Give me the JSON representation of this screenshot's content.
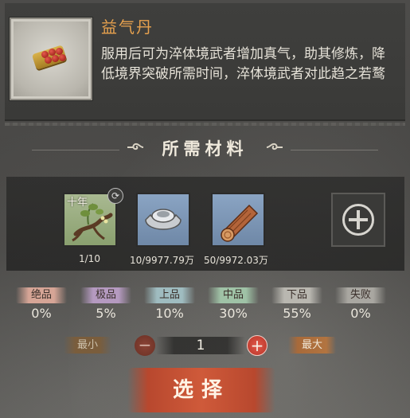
{
  "item": {
    "name": "益气丹",
    "description": "服用后可为淬体境武者增加真气，助其修炼，降低境界突破所需时间，淬体境武者对此趋之若鹜"
  },
  "materials_section": {
    "title": "所需材料"
  },
  "materials": [
    {
      "icon": "herb-root-icon",
      "tag": "十年",
      "count": "1/10"
    },
    {
      "icon": "silver-ingot-icon",
      "count": "10/9977.79万"
    },
    {
      "icon": "wood-log-icon",
      "count": "50/9972.03万"
    }
  ],
  "grades": [
    {
      "label": "绝品",
      "value": "0%",
      "color": "#d6a596"
    },
    {
      "label": "极品",
      "value": "5%",
      "color": "#b59ac0"
    },
    {
      "label": "上品",
      "value": "10%",
      "color": "#9fbcc0"
    },
    {
      "label": "中品",
      "value": "30%",
      "color": "#9fc2a6"
    },
    {
      "label": "下品",
      "value": "55%",
      "color": "#b9b7b0"
    },
    {
      "label": "失败",
      "value": "0%",
      "color": "#a9a7a1"
    }
  ],
  "quantity": {
    "min_label": "最小",
    "max_label": "最大",
    "value": "1"
  },
  "select_label": "选择"
}
